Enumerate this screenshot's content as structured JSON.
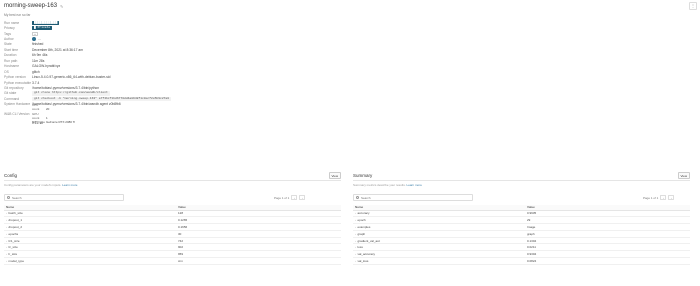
{
  "header": {
    "title": "morning-sweep-163",
    "subtitle": "My best run so far",
    "menu_icon": "more-icon"
  },
  "overview": [
    {
      "key": "Run name",
      "value": "█████████████",
      "kind": "highlight"
    },
    {
      "key": "Privacy",
      "value": "█ Private",
      "kind": "highlight"
    },
    {
      "key": "Tags",
      "value": "+",
      "kind": "tag"
    },
    {
      "key": "Author",
      "value": "...",
      "kind": "author"
    },
    {
      "key": "State",
      "value": "finished",
      "kind": "text"
    },
    {
      "key": "Start time",
      "value": "December 8th, 2021 at 8:36:17 am",
      "kind": "text"
    },
    {
      "key": "Duration",
      "value": "6h 9m 46s",
      "kind": "text"
    },
    {
      "key": "Run path",
      "value": "11m 28s",
      "kind": "text"
    },
    {
      "key": "Hostname",
      "value": "GALGW-hyrabl/xyz",
      "kind": "text"
    },
    {
      "key": "OS",
      "value": "glitch",
      "kind": "text"
    },
    {
      "key": "Python version",
      "value": "Linux-5.4.0-97-generic-x86_64-with-debian-buster-sid",
      "kind": "text"
    },
    {
      "key": "Python executable",
      "value": "3.7.4",
      "kind": "text"
    },
    {
      "key": "Git repository",
      "value": "/home/tobias/.pyenv/versions/3.7.4/bin/python",
      "kind": "text"
    },
    {
      "key": "Git state",
      "value": "git clone https://github.com/wandb/client",
      "kind": "code"
    },
    {
      "key": "Command",
      "value": "git checkout -b \"morning-sweep-163\" a7f3bcf1bd6770dd4a8948f1c0ecf2e5b9c27a0",
      "kind": "code"
    },
    {
      "key": "System Hardware",
      "value": "/home/tobias/.pyenv/versions/3.7.4/bin/wandb agent z0b8fb6",
      "kind": "text"
    },
    {
      "key": "W&B CLI Version",
      "value": "",
      "kind": "gpu"
    },
    {
      "key": "",
      "value": "0.12.10",
      "kind": "text"
    }
  ],
  "hardware": {
    "cpu_label": "CPU count",
    "cpu_value": "20",
    "gpu_count_label": "GPU count",
    "gpu_count_value": "1",
    "gpu_type_label": "GPU type",
    "gpu_type_value": "GeForce RTX 2080 Ti"
  },
  "config": {
    "title": "Config",
    "view_label": "View",
    "description": "Config parameters are your model's inputs.",
    "learn_more": "Learn more",
    "search_placeholder": "Search",
    "pager_text": "Page 1 of 1",
    "col_name": "Name",
    "col_value": "Value",
    "rows": [
      {
        "name": "batch_size",
        "value": "128"
      },
      {
        "name": "dropout_1",
        "value": "0.1265"
      },
      {
        "name": "dropout_2",
        "value": "0.1656"
      },
      {
        "name": "epochs",
        "value": "30"
      },
      {
        "name": "fc1_size",
        "value": "742"
      },
      {
        "name": "fc_size",
        "value": "902"
      },
      {
        "name": "lr_size",
        "value": "959"
      },
      {
        "name": "model_type",
        "value": "cnn"
      }
    ]
  },
  "summary": {
    "title": "Summary",
    "view_label": "View",
    "description": "Summary metrics describe your results.",
    "learn_more": "Learn more",
    "search_placeholder": "Search",
    "pager_text": "Page 1 of 1",
    "col_name": "Name",
    "col_value": "Value",
    "rows": [
      {
        "name": "accuracy",
        "value": "0.9935"
      },
      {
        "name": "epoch",
        "value": "29"
      },
      {
        "name": "examples",
        "value": "Image"
      },
      {
        "name": "graph",
        "value": "graph"
      },
      {
        "name": "gradient_val_acc",
        "value": "0.1304"
      },
      {
        "name": "loss",
        "value": "0.0211"
      },
      {
        "name": "val_accuracy",
        "value": "0.9304"
      },
      {
        "name": "val_loss",
        "value": "0.0824"
      }
    ]
  }
}
